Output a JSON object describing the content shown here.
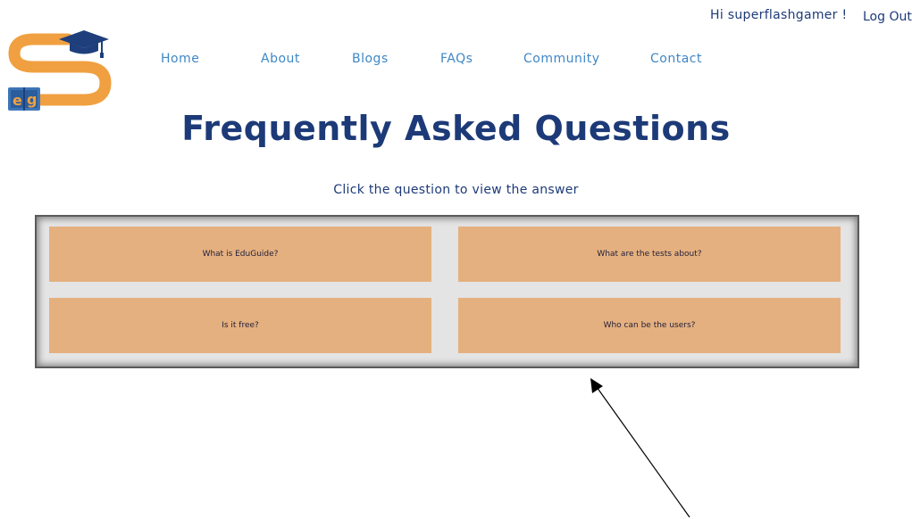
{
  "header": {
    "greeting": "Hi superflashgamer !",
    "logout_label": "Log Out"
  },
  "logo": {
    "letters": "eg",
    "colors": {
      "orange": "#f0a040",
      "navy": "#1e3f7c",
      "book_blue": "#3d75b8"
    }
  },
  "nav": {
    "items": [
      {
        "label": "Home"
      },
      {
        "label": "About"
      },
      {
        "label": "Blogs"
      },
      {
        "label": "FAQs"
      },
      {
        "label": "Community"
      },
      {
        "label": "Contact"
      }
    ]
  },
  "main": {
    "title": "Frequently Asked Questions",
    "subtitle": "Click the question to view the answer"
  },
  "faq": {
    "questions": [
      {
        "label": "What is EduGuide?"
      },
      {
        "label": "What are the tests about?"
      },
      {
        "label": "Is it free?"
      },
      {
        "label": "Who can be the users?"
      }
    ]
  },
  "colors": {
    "title_navy": "#1d3a78",
    "nav_blue": "#3f87c6",
    "card_orange": "#e5b07f",
    "panel_gray": "#e4e4e4"
  }
}
